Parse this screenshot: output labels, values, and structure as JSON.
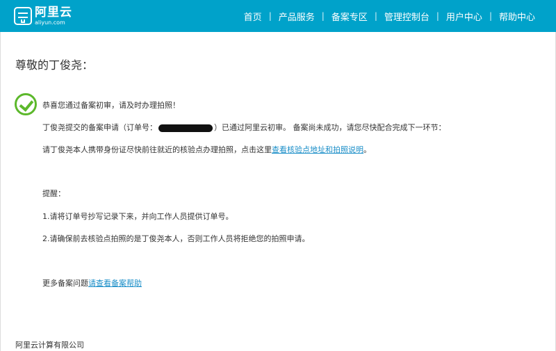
{
  "header": {
    "logo_cn": "阿里云",
    "logo_en": "aliyun.com",
    "nav": [
      "首页",
      "产品服务",
      "备案专区",
      "管理控制台",
      "用户中心",
      "帮助中心"
    ],
    "nav_separator": "|"
  },
  "content": {
    "greeting": "尊敬的丁俊尧：",
    "congrats": "恭喜您通过备案初审，请及时办理拍照！",
    "order_prefix": "丁俊尧提交的备案申请（订单号：",
    "order_suffix": "）已通过阿里云初审。 备案尚未成功，请您尽快配合完成下一环节：",
    "photo_text": "请丁俊尧本人携带身份证尽快前往就近的核验点办理拍照，点击这里",
    "photo_link": "查看核验点地址和拍照说明",
    "photo_end": "。",
    "reminder_title": "提醒：",
    "reminder_1": "1.请将订单号抄写记录下来，并向工作人员提供订单号。",
    "reminder_2": "2.请确保前去核验点拍照的是丁俊尧本人，否则工作人员将拒绝您的拍照申请。",
    "help_prefix": "更多备案问题",
    "help_link": "请查看备案帮助"
  },
  "footer": {
    "company": "阿里云计算有限公司"
  },
  "colors": {
    "header_bg": "#00a2ca",
    "check_green": "#5cb82b",
    "link_blue": "#1a8ec8"
  }
}
